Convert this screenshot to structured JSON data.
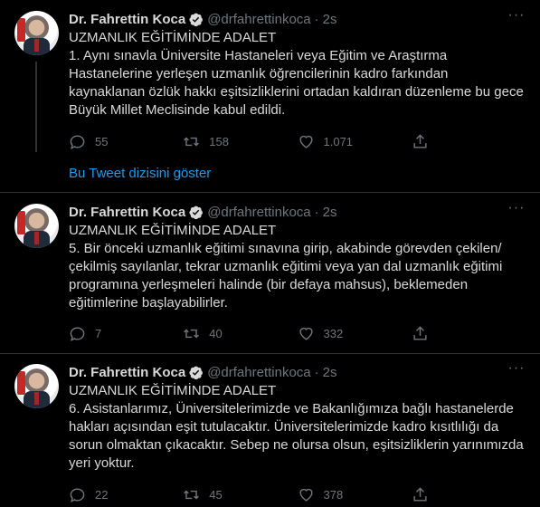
{
  "author": {
    "name": "Dr. Fahrettin Koca",
    "handle": "@drfahrettinkoca",
    "dot": "·",
    "time": "2s"
  },
  "show_thread": "Bu Tweet dizisini göster",
  "tweets": [
    {
      "title": "UZMANLIK EĞİTİMİNDE ADALET",
      "lines": [
        "1. Aynı sınavla Üniversite Hastaneleri veya Eğitim ve Araştırma",
        "Hastanelerine yerleşen uzmanlık öğrencilerinin kadro farkından",
        "kaynaklanan özlük hakkı eşitsizliklerini ortadan kaldıran düzenleme bu gece",
        "Büyük Millet Meclisinde kabul edildi."
      ],
      "replies": "55",
      "retweets": "158",
      "likes": "1.071"
    },
    {
      "title": "UZMANLIK EĞİTİMİNDE ADALET",
      "lines": [
        "5. Bir önceki uzmanlık eğitimi sınavına girip, akabinde görevden çekilen/",
        "çekilmiş sayılanlar, tekrar uzmanlık eğitimi veya yan dal uzmanlık eğitimi",
        "programına yerleşmeleri halinde (bir defaya mahsus), beklemeden",
        "eğitimlerine başlayabilirler."
      ],
      "replies": "7",
      "retweets": "40",
      "likes": "332"
    },
    {
      "title": "UZMANLIK EĞİTİMİNDE ADALET",
      "lines": [
        "6. Asistanlarımız, Üniversitelerimizde ve Bakanlığımıza bağlı hastanelerde",
        "hakları açısından eşit tutulacaktır. Üniversitelerimizde kadro kısıtlılığı da",
        "sorun olmaktan çıkacaktır. Sebep ne olursa olsun, eşitsizliklerin yarınımızda",
        "yeri yoktur."
      ],
      "replies": "22",
      "retweets": "45",
      "likes": "378"
    }
  ],
  "colors": {
    "background": "#000000",
    "text": "#d9d9d9",
    "muted": "#6e767d",
    "link": "#1d9bf0"
  }
}
